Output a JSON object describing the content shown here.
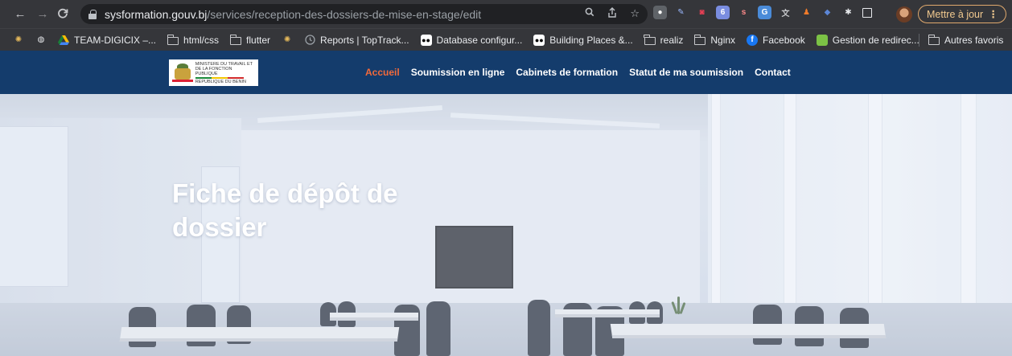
{
  "browser": {
    "url_host": "sysformation.gouv.bj",
    "url_path": "/services/reception-des-dossiers-de-mise-en-stage/edit",
    "update_button": "Mettre à jour",
    "bookmarks": [
      {
        "label": "",
        "icon": "spider-icon"
      },
      {
        "label": "",
        "icon": "globe-icon"
      },
      {
        "label": "TEAM-DIGICIX –...",
        "icon": "drive-icon"
      },
      {
        "label": "html/css",
        "icon": "folder-icon"
      },
      {
        "label": "flutter",
        "icon": "folder-icon"
      },
      {
        "label": "",
        "icon": "spider-icon"
      },
      {
        "label": "Reports | TopTrack...",
        "icon": "clock-icon"
      },
      {
        "label": "Database configur...",
        "icon": "medium-icon"
      },
      {
        "label": "Building Places &...",
        "icon": "medium-icon"
      },
      {
        "label": "realiz",
        "icon": "folder-icon"
      },
      {
        "label": "Nginx",
        "icon": "folder-icon"
      },
      {
        "label": "Facebook",
        "icon": "facebook-icon"
      },
      {
        "label": "Gestion de redirec...",
        "icon": "green-square-icon"
      }
    ],
    "other_bookmarks": "Autres favoris"
  },
  "site": {
    "logo_lines": [
      "MINISTERE DU TRAVAIL ET",
      "DE LA FONCTION PUBLIQUE",
      "REPUBLIQUE DU BENIN"
    ],
    "nav": [
      {
        "label": "Accueil",
        "active": true
      },
      {
        "label": "Soumission en ligne",
        "active": false
      },
      {
        "label": "Cabinets de formation",
        "active": false
      },
      {
        "label": "Statut de ma soumission",
        "active": false
      },
      {
        "label": "Contact",
        "active": false
      }
    ],
    "colors": {
      "header": "#143c6c",
      "active": "#f26a3b"
    }
  },
  "hero": {
    "title": "Fiche de dépôt de dossier"
  }
}
